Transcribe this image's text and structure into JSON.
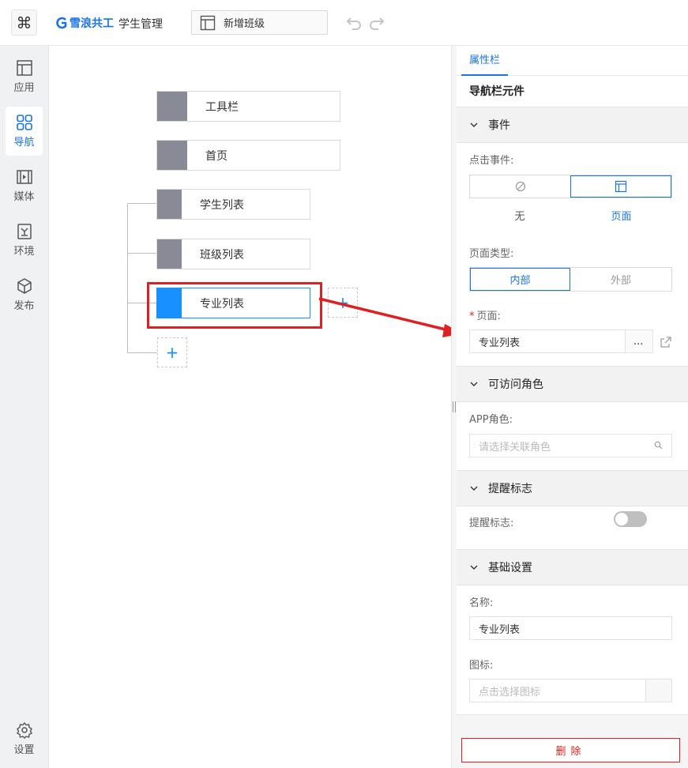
{
  "topbar": {
    "app_icon": "command-icon",
    "brand_name": "雪浪共工",
    "app_name": "学生管理",
    "current_page": "新增班级"
  },
  "sidebar": {
    "items": [
      {
        "label": "应用",
        "icon": "layout-icon"
      },
      {
        "label": "导航",
        "icon": "grid-icon",
        "active": true
      },
      {
        "label": "媒体",
        "icon": "media-icon"
      },
      {
        "label": "环境",
        "icon": "environment-icon"
      },
      {
        "label": "发布",
        "icon": "cube-icon"
      }
    ],
    "settings_label": "设置"
  },
  "tree": {
    "toolbar_label": "工具栏",
    "home_label": "首页",
    "children": [
      "学生列表",
      "班级列表",
      "专业列表"
    ],
    "add_symbol": "+"
  },
  "panel": {
    "tab": "属性栏",
    "title": "导航栏元件",
    "sections": {
      "event": {
        "title": "事件",
        "click_label": "点击事件:",
        "click_options": [
          "无",
          "页面"
        ],
        "page_type_label": "页面类型:",
        "page_type_options": [
          "内部",
          "外部"
        ],
        "page_label": "页面:",
        "page_value": "专业列表",
        "page_more": "..."
      },
      "roles": {
        "title": "可访问角色",
        "app_role_label": "APP角色:",
        "app_role_placeholder": "请选择关联角色"
      },
      "reminder": {
        "title": "提醒标志",
        "label": "提醒标志:",
        "enabled": false
      },
      "basic": {
        "title": "基础设置",
        "name_label": "名称:",
        "name_value": "专业列表",
        "icon_label": "图标:",
        "icon_placeholder": "点击选择图标"
      }
    },
    "delete_label": "删除"
  },
  "colors": {
    "accent": "#1a73e8",
    "selected_node": "#1890ff",
    "annotation_red": "#e02020",
    "node_gray": "#888a95"
  }
}
